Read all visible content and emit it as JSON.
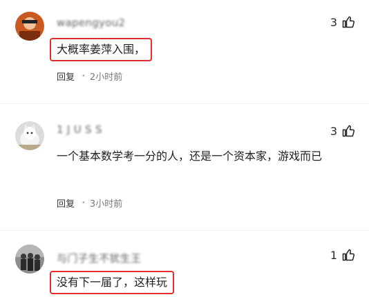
{
  "comments": [
    {
      "username": "wapengyou2",
      "likes": "3",
      "text": "大概率姜萍入围，",
      "reply_label": "回复",
      "time": "2小时前"
    },
    {
      "username": "1 J U S S",
      "likes": "3",
      "text": "一个基本数学考一分的人，还是一个资本家，游戏而已",
      "reply_label": "回复",
      "time": "3小时前"
    },
    {
      "username": "与门子生不犹生王",
      "likes": "1",
      "text": "没有下一届了，这样玩"
    }
  ],
  "icons": {
    "like": "thumbs-up-icon"
  },
  "colors": {
    "highlight_border": "#e32b2b"
  }
}
